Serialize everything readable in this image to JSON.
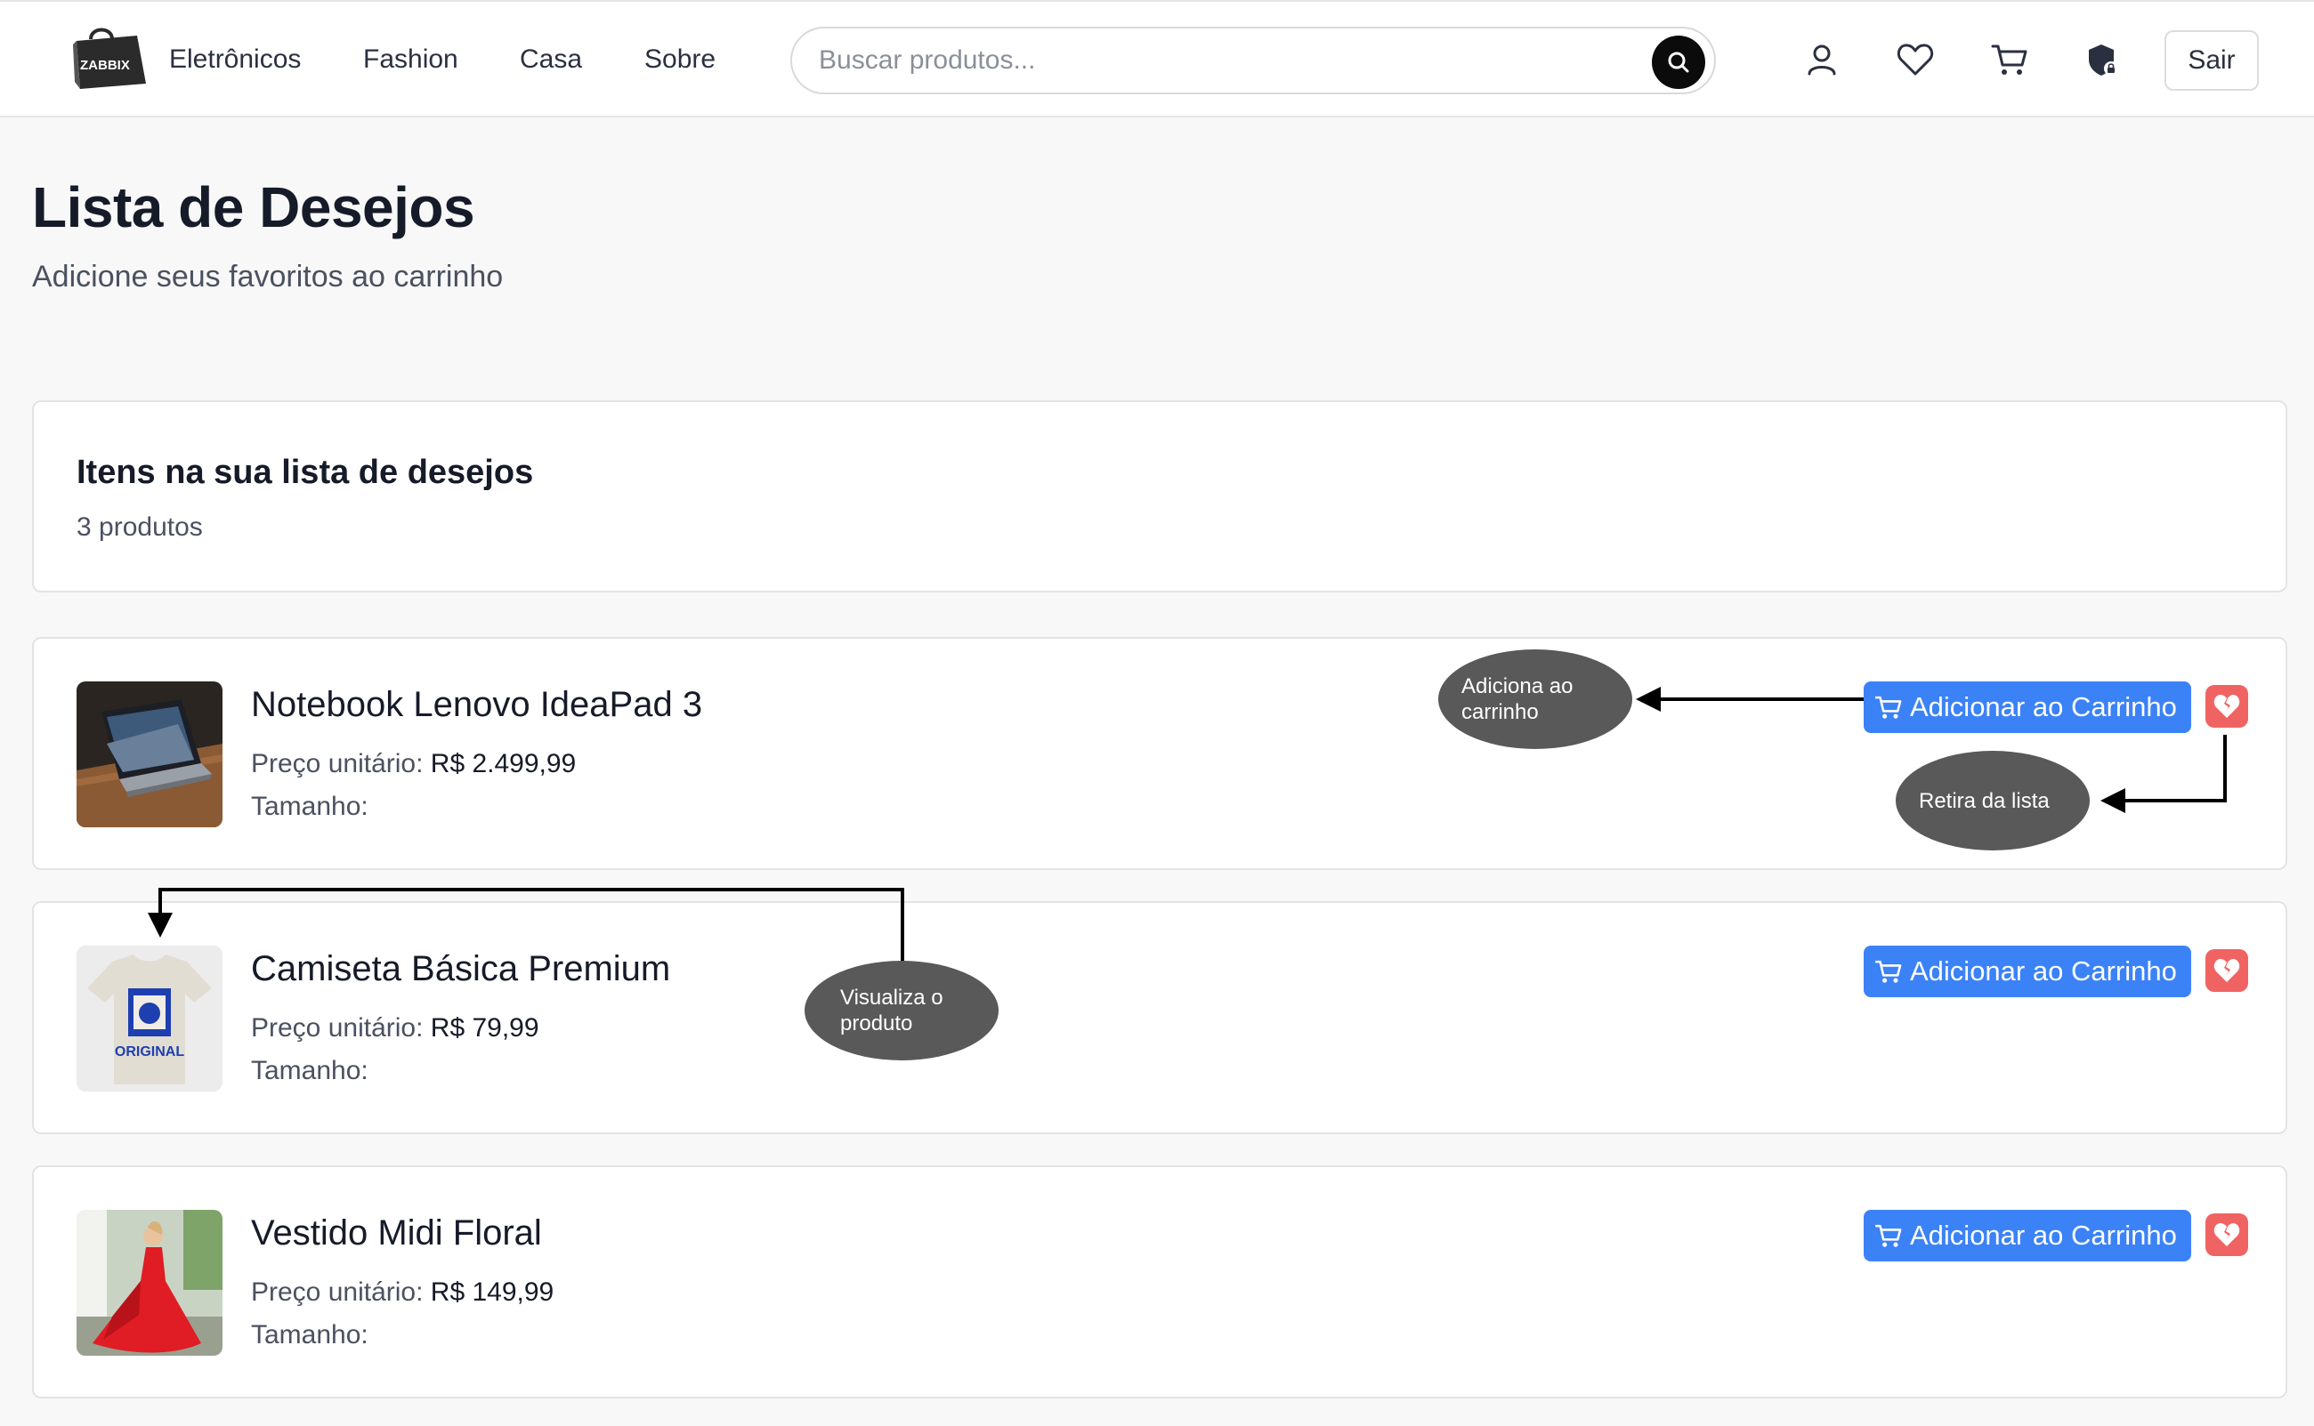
{
  "header": {
    "logo_text": "ZABBIX",
    "nav": [
      "Eletrônicos",
      "Fashion",
      "Casa",
      "Sobre"
    ],
    "search_placeholder": "Buscar produtos...",
    "logout_label": "Sair"
  },
  "page": {
    "title": "Lista de Desejos",
    "subtitle": "Adicione seus favoritos ao carrinho"
  },
  "summary": {
    "title": "Itens na sua lista de desejos",
    "count": "3 produtos"
  },
  "items": [
    {
      "name": "Notebook Lenovo IdeaPad 3",
      "price_label": "Preço unitário:",
      "price": "R$ 2.499,99",
      "size_label": "Tamanho:",
      "add_label": "Adicionar ao Carrinho"
    },
    {
      "name": "Camiseta Básica Premium",
      "price_label": "Preço unitário:",
      "price": "R$ 79,99",
      "size_label": "Tamanho:",
      "add_label": "Adicionar ao Carrinho"
    },
    {
      "name": "Vestido Midi Floral",
      "price_label": "Preço unitário:",
      "price": "R$ 149,99",
      "size_label": "Tamanho:",
      "add_label": "Adicionar ao Carrinho"
    }
  ],
  "annotations": {
    "add_to_cart": [
      "Adiciona ao",
      "carrinho"
    ],
    "remove": [
      "Retira da lista"
    ],
    "view_product": [
      "Visualiza o",
      "produto"
    ]
  },
  "icons": {
    "search": "search-icon",
    "account": "user-icon",
    "wishlist": "heart-icon",
    "cart": "cart-icon",
    "admin": "shield-lock-icon",
    "remove": "broken-heart-icon"
  },
  "colors": {
    "primary": "#3b82f6",
    "danger": "#f06363",
    "annotation": "#595959"
  }
}
